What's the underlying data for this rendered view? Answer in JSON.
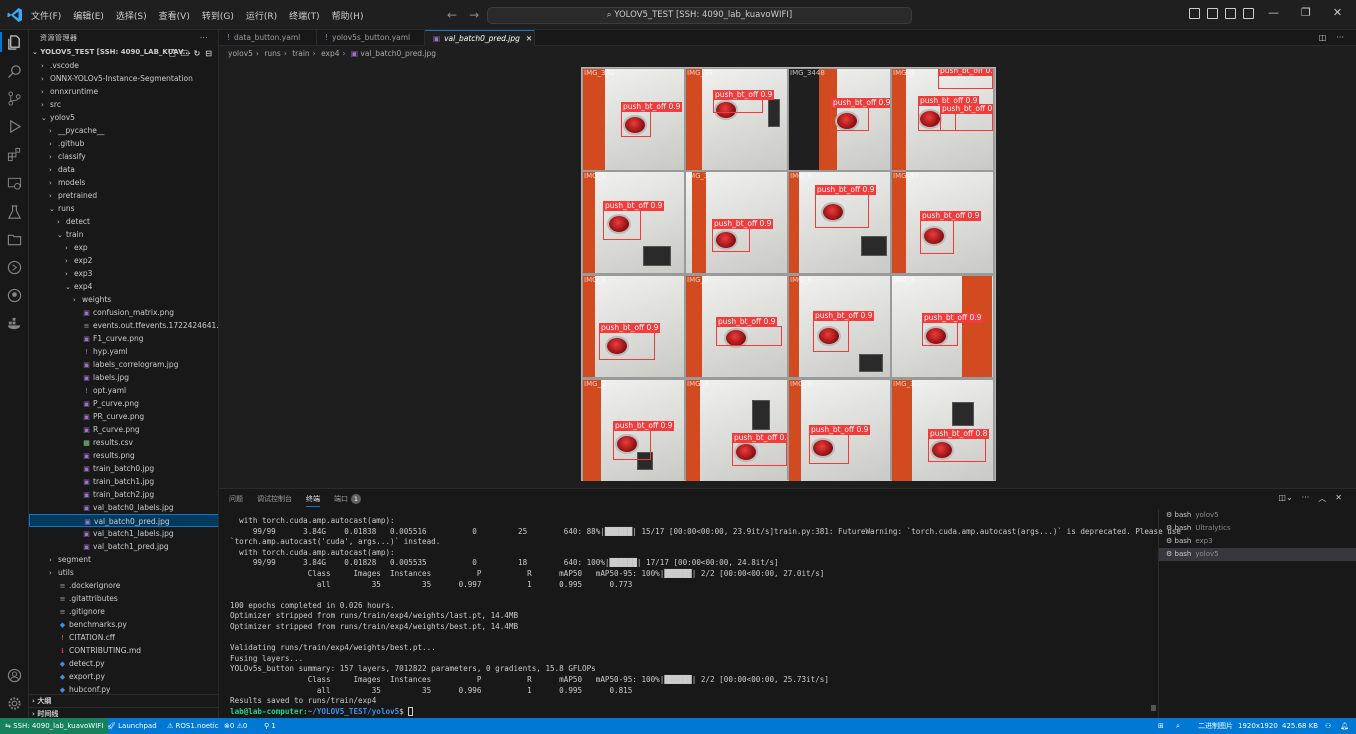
{
  "titlebar": {
    "menus": [
      "文件(F)",
      "编辑(E)",
      "选择(S)",
      "查看(V)",
      "转到(G)",
      "运行(R)",
      "终端(T)",
      "帮助(H)"
    ],
    "command_center": "YOLOV5_TEST [SSH: 4090_lab_kuavoWIFI]"
  },
  "sidebar": {
    "title": "资源管理器",
    "root": "YOLOV5_TEST [SSH: 4090_LAB_KUAV...",
    "tree": [
      {
        "label": ".vscode",
        "indent": 1,
        "type": "folder",
        "open": false
      },
      {
        "label": "ONNX-YOLOv5-Instance-Segmentation",
        "indent": 1,
        "type": "folder",
        "open": false
      },
      {
        "label": "onnxruntime",
        "indent": 1,
        "type": "folder",
        "open": false
      },
      {
        "label": "src",
        "indent": 1,
        "type": "folder",
        "open": false
      },
      {
        "label": "yolov5",
        "indent": 1,
        "type": "folder",
        "open": true
      },
      {
        "label": "__pycache__",
        "indent": 2,
        "type": "folder",
        "open": false
      },
      {
        "label": ".github",
        "indent": 2,
        "type": "folder",
        "open": false
      },
      {
        "label": "classify",
        "indent": 2,
        "type": "folder",
        "open": false
      },
      {
        "label": "data",
        "indent": 2,
        "type": "folder",
        "open": false
      },
      {
        "label": "models",
        "indent": 2,
        "type": "folder",
        "open": false
      },
      {
        "label": "pretrained",
        "indent": 2,
        "type": "folder",
        "open": false
      },
      {
        "label": "runs",
        "indent": 2,
        "type": "folder",
        "open": true
      },
      {
        "label": "detect",
        "indent": 3,
        "type": "folder",
        "open": false
      },
      {
        "label": "train",
        "indent": 3,
        "type": "folder",
        "open": true
      },
      {
        "label": "exp",
        "indent": 4,
        "type": "folder",
        "open": false
      },
      {
        "label": "exp2",
        "indent": 4,
        "type": "folder",
        "open": false
      },
      {
        "label": "exp3",
        "indent": 4,
        "type": "folder",
        "open": false
      },
      {
        "label": "exp4",
        "indent": 4,
        "type": "folder",
        "open": true
      },
      {
        "label": "weights",
        "indent": 5,
        "type": "folder",
        "open": false
      },
      {
        "label": "confusion_matrix.png",
        "indent": 5,
        "type": "image"
      },
      {
        "label": "events.out.tfevents.1722424641.lab-comp...",
        "indent": 5,
        "type": "file"
      },
      {
        "label": "F1_curve.png",
        "indent": 5,
        "type": "image"
      },
      {
        "label": "hyp.yaml",
        "indent": 5,
        "type": "yaml"
      },
      {
        "label": "labels_correlogram.jpg",
        "indent": 5,
        "type": "image"
      },
      {
        "label": "labels.jpg",
        "indent": 5,
        "type": "image"
      },
      {
        "label": "opt.yaml",
        "indent": 5,
        "type": "yaml"
      },
      {
        "label": "P_curve.png",
        "indent": 5,
        "type": "image"
      },
      {
        "label": "PR_curve.png",
        "indent": 5,
        "type": "image"
      },
      {
        "label": "R_curve.png",
        "indent": 5,
        "type": "image"
      },
      {
        "label": "results.csv",
        "indent": 5,
        "type": "csv"
      },
      {
        "label": "results.png",
        "indent": 5,
        "type": "image"
      },
      {
        "label": "train_batch0.jpg",
        "indent": 5,
        "type": "image"
      },
      {
        "label": "train_batch1.jpg",
        "indent": 5,
        "type": "image"
      },
      {
        "label": "train_batch2.jpg",
        "indent": 5,
        "type": "image"
      },
      {
        "label": "val_batch0_labels.jpg",
        "indent": 5,
        "type": "image"
      },
      {
        "label": "val_batch0_pred.jpg",
        "indent": 5,
        "type": "image",
        "selected": true
      },
      {
        "label": "val_batch1_labels.jpg",
        "indent": 5,
        "type": "image"
      },
      {
        "label": "val_batch1_pred.jpg",
        "indent": 5,
        "type": "image"
      },
      {
        "label": "segment",
        "indent": 2,
        "type": "folder",
        "open": false
      },
      {
        "label": "utils",
        "indent": 2,
        "type": "folder",
        "open": false
      },
      {
        "label": ".dockerignore",
        "indent": 2,
        "type": "file"
      },
      {
        "label": ".gitattributes",
        "indent": 2,
        "type": "file"
      },
      {
        "label": ".gitignore",
        "indent": 2,
        "type": "file"
      },
      {
        "label": "benchmarks.py",
        "indent": 2,
        "type": "python"
      },
      {
        "label": "CITATION.cff",
        "indent": 2,
        "type": "cff"
      },
      {
        "label": "CONTRIBUTING.md",
        "indent": 2,
        "type": "md"
      },
      {
        "label": "detect.py",
        "indent": 2,
        "type": "python"
      },
      {
        "label": "export.py",
        "indent": 2,
        "type": "python"
      },
      {
        "label": "hubconf.py",
        "indent": 2,
        "type": "python"
      }
    ],
    "outline": "大纲",
    "timeline": "时间线"
  },
  "tabs": [
    {
      "label": "data_button.yaml"
    },
    {
      "label": "yolov5s_button.yaml"
    },
    {
      "label": "val_batch0_pred.jpg",
      "active": true
    }
  ],
  "breadcrumb": [
    "yolov5",
    "runs",
    "train",
    "exp4",
    "val_batch0_pred.jpg"
  ],
  "image": {
    "cells": [
      {
        "fname": "IMG_382",
        "dets": [
          {
            "label": "push_bt_off 0.9"
          }
        ]
      },
      {
        "fname": "IMG_38",
        "dets": [
          {
            "label": "push_bt_off 0.9"
          }
        ]
      },
      {
        "fname": "IMG_3448",
        "dets": [
          {
            "label": "push_bt_off 0.9"
          }
        ]
      },
      {
        "fname": "IMG_3",
        "dets": [
          {
            "label": "push_bt_off 0.5"
          },
          {
            "label": "push_bt_off 0.9"
          },
          {
            "label": "push_bt_off 0.9"
          }
        ]
      },
      {
        "fname": "IMG_3",
        "dets": [
          {
            "label": "push_bt_off 0.9"
          }
        ]
      },
      {
        "fname": "IMG_3",
        "dets": [
          {
            "label": "push_bt_off 0.9"
          }
        ]
      },
      {
        "fname": "IMG_3",
        "dets": [
          {
            "label": "push_bt_off 0.9"
          }
        ]
      },
      {
        "fname": "IMG_37",
        "dets": [
          {
            "label": "push_bt_off 0.9"
          }
        ]
      },
      {
        "fname": "IMG_3",
        "dets": [
          {
            "label": "push_bt_off 0.9"
          }
        ]
      },
      {
        "fname": "IMG_3",
        "dets": [
          {
            "label": "push_bt_off 0.9"
          }
        ]
      },
      {
        "fname": "IMG_3",
        "dets": [
          {
            "label": "push_bt_off 0.9"
          }
        ]
      },
      {
        "fname": "IMG_3",
        "dets": [
          {
            "label": "push_bt_off 0.9"
          }
        ]
      },
      {
        "fname": "IMG_3",
        "dets": [
          {
            "label": "push_bt_off 0.9"
          }
        ]
      },
      {
        "fname": "IMG_3",
        "dets": [
          {
            "label": "push_bt_off 0.9"
          }
        ]
      },
      {
        "fname": "IMG_3",
        "dets": [
          {
            "label": "push_bt_off 0.9"
          }
        ]
      },
      {
        "fname": "IMG_3",
        "dets": [
          {
            "label": "push_bt_off 0.8"
          }
        ]
      }
    ]
  },
  "panel": {
    "tabs": [
      "问题",
      "调试控制台",
      "终端",
      "端口"
    ],
    "active_tab": "终端",
    "ports_badge": "1",
    "terminal_lines": [
      "  with torch.cuda.amp.autocast(amp):",
      "     99/99      3.84G    0.01838   0.005516          0         25        640: 88%|██████| 15/17 [00:00<00:00, 23.9it/s]train.py:381: FutureWarning: `torch.cuda.amp.autocast(args...)` is deprecated. Please use",
      "`torch.amp.autocast('cuda', args...)` instead.",
      "  with torch.cuda.amp.autocast(amp):",
      "     99/99      3.84G    0.01828   0.005535          0         18        640: 100%|██████| 17/17 [00:00<00:00, 24.8it/s]",
      "                 Class     Images  Instances          P          R      mAP50   mAP50-95: 100%|██████| 2/2 [00:00<00:00, 27.0it/s]",
      "                   all         35         35      0.997          1      0.995      0.773",
      "",
      "100 epochs completed in 0.026 hours.",
      "Optimizer stripped from runs/train/exp4/weights/last.pt, 14.4MB",
      "Optimizer stripped from runs/train/exp4/weights/best.pt, 14.4MB",
      "",
      "Validating runs/train/exp4/weights/best.pt...",
      "Fusing layers...",
      "YOLOv5s_button summary: 157 layers, 7012822 parameters, 0 gradients, 15.8 GFLOPs",
      "                 Class     Images  Instances          P          R      mAP50   mAP50-95: 100%|██████| 2/2 [00:00<00:00, 25.73it/s]",
      "                   all         35         35      0.996          1      0.995      0.815",
      "Results saved to runs/train/exp4"
    ],
    "prompt_user": "lab@lab-computer",
    "prompt_path": "~/YOLOV5_TEST/yolov5",
    "prompt_symbol": "$",
    "terminals": [
      {
        "name": "bash",
        "sub": "yolov5"
      },
      {
        "name": "bash",
        "sub": "Ultralytics"
      },
      {
        "name": "bash",
        "sub": "exp3"
      },
      {
        "name": "bash",
        "sub": "yolov5",
        "active": true
      }
    ]
  },
  "statusbar": {
    "remote": "SSH: 4090_lab_kuavoWIFI",
    "launchpad": "Launchpad",
    "ros": "ROS1.noetic",
    "errors": "0",
    "warnings": "0",
    "ports": "1",
    "binary_image": "二进制图片",
    "dimensions": "1920x1920",
    "size": "425.68 KB",
    "colors": {
      "bar": "#0078d4",
      "remote": "#16825d"
    }
  }
}
